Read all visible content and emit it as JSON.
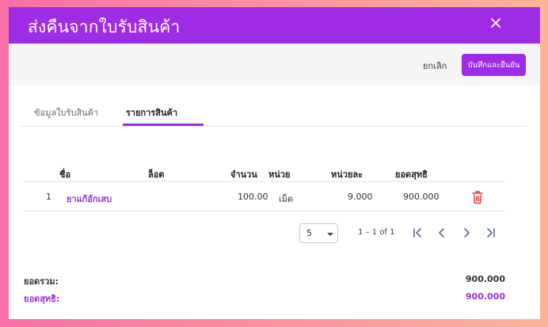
{
  "dialog": {
    "title": "ส่งคืนจากใบรับสินค้า"
  },
  "actions": {
    "cancel_label": "ยกเลิก",
    "save_label": "บันทึกและยืนยัน"
  },
  "tabs": [
    {
      "label": "ข้อมูลใบรับสินค้า",
      "active": false
    },
    {
      "label": "รายการสินค้า",
      "active": true
    }
  ],
  "table": {
    "columns": [
      "ชื่อ",
      "ล็อต",
      "จำนวน",
      "หน่วย",
      "หน่วยละ",
      "ยอดสุทธิ"
    ],
    "rows": [
      {
        "index": "1",
        "name": "ยาแก้อักเสบ",
        "lot": "",
        "qty": "100.00",
        "unit": "เม็ด",
        "unit_price": "9.000",
        "net": "900.000"
      }
    ]
  },
  "pagination": {
    "page_size": "5",
    "range": "1 – 1 of 1"
  },
  "totals": {
    "subtotal_label": "ยอดรวม:",
    "subtotal_value": "900.000",
    "net_label": "ยอดสุทธิ:",
    "net_value": "900.000"
  },
  "colors": {
    "accent": "#9f2ce5",
    "delete": "#e53935"
  },
  "icons": [
    "close-icon",
    "trash-icon",
    "first-page-icon",
    "prev-page-icon",
    "next-page-icon",
    "last-page-icon",
    "chevron-down-icon"
  ]
}
